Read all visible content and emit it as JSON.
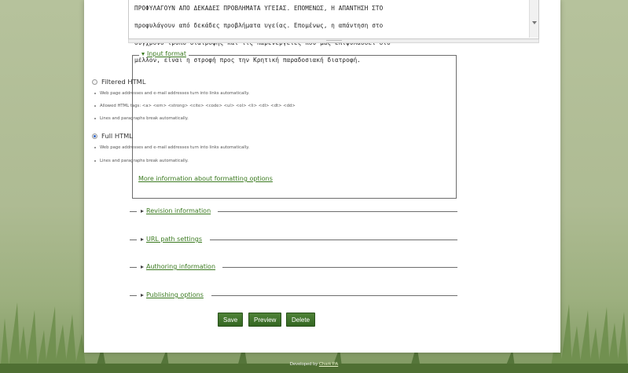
{
  "textarea": {
    "lines": [
      "ΠΡΟΦΥΛΑΓΟΥΝ ΑΠΟ ΔΕΚΑΔΕΣ ΠΡΟΒΛΗΜΑΤΑ ΥΓΕΙΑΣ. ΕΠΟΜΕΝΩΣ, Η ΑΠΑΝΤΗΣΗ ΣΤΟ",
      "προφυλάγουν από δεκάδες προβλήματα υγείας. Επομένως, η απάντηση στο",
      "σύγχρονο τρόπο διατροφής και τις παρενέργειες που μας επιφυλάσσει στο",
      "μέλλον, είναι η στροφή προς την Κρητική παραδοσιακή διατροφή."
    ]
  },
  "input_format": {
    "legend": "Input format",
    "options": [
      {
        "label": "Filtered HTML",
        "selected": false,
        "tips": [
          "Web page addresses and e-mail addresses turn into links automatically.",
          "Allowed HTML tags: <a> <em> <strong> <cite> <code> <ul> <ol> <li> <dl> <dt> <dd>",
          "Lines and paragraphs break automatically."
        ]
      },
      {
        "label": "Full HTML",
        "selected": true,
        "tips": [
          "Web page addresses and e-mail addresses turn into links automatically.",
          "Lines and paragraphs break automatically."
        ]
      }
    ],
    "more_link": "More information about formatting options"
  },
  "collapsed_sections": [
    "Revision information",
    "URL path settings",
    "Authoring information",
    "Publishing options"
  ],
  "buttons": {
    "save": "Save",
    "preview": "Preview",
    "delete": "Delete"
  },
  "footer": {
    "prefix": "Developed by",
    "link": "Chark PA"
  },
  "colors": {
    "link_green": "#3b7a20",
    "button_green": "#3f7329",
    "background": "#aebb93"
  }
}
